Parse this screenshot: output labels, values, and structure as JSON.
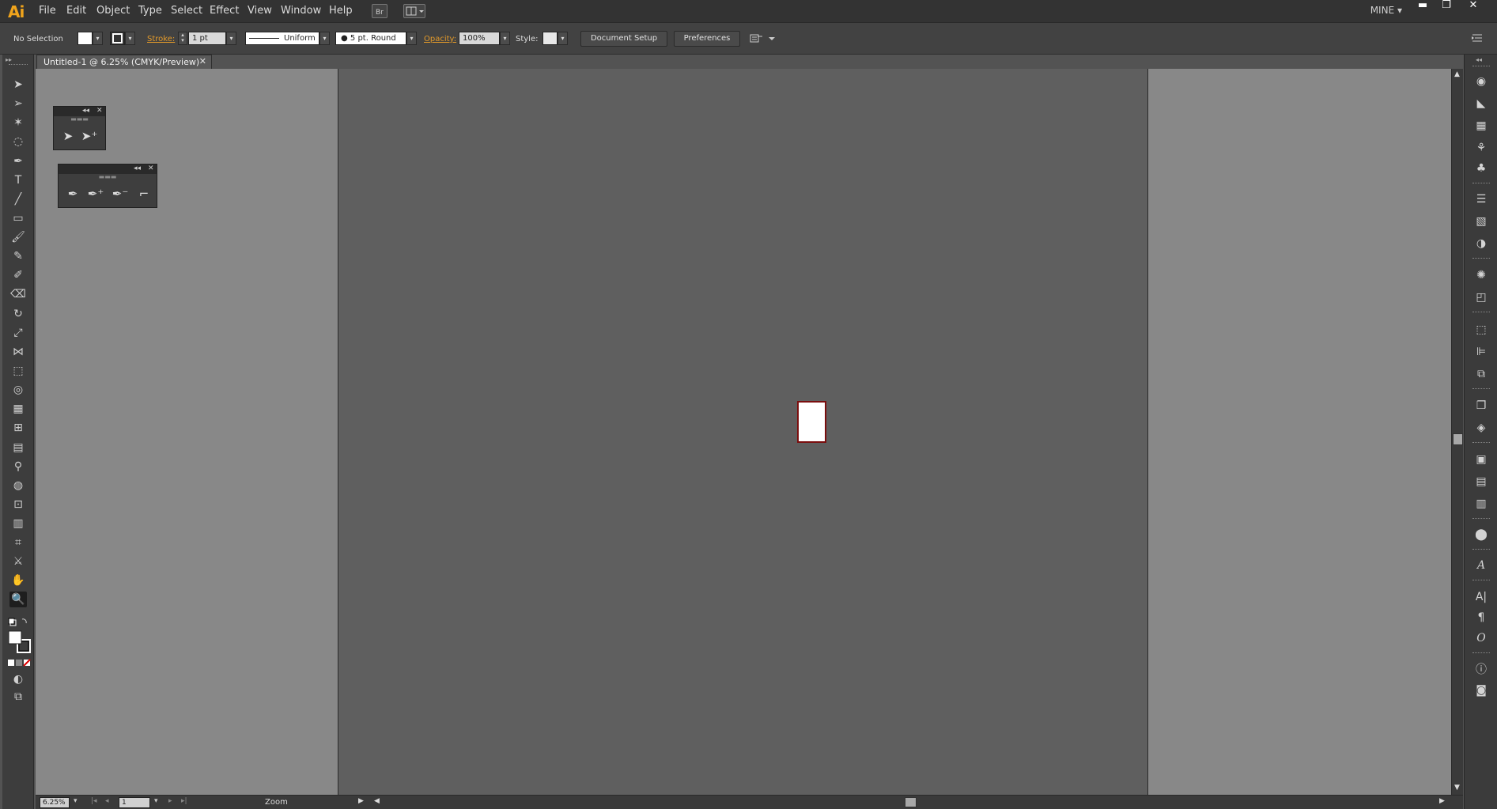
{
  "app": {
    "logo": "Ai",
    "workspace": "MINE"
  },
  "menu": [
    "File",
    "Edit",
    "Object",
    "Type",
    "Select",
    "Effect",
    "View",
    "Window",
    "Help"
  ],
  "menubar_icons": [
    "bridge-icon",
    "arrange-documents-icon"
  ],
  "window_controls": {
    "minimize": "▬",
    "maximize": "❐",
    "close": "✕"
  },
  "control_bar": {
    "selection": "No Selection",
    "stroke_label": "Stroke:",
    "stroke_weight": "1 pt",
    "stroke_profile": "Uniform",
    "brush": "● 5 pt. Round",
    "opacity_label": "Opacity:",
    "opacity_value": "100%",
    "style_label": "Style:",
    "document_setup": "Document Setup",
    "preferences": "Preferences",
    "colors": {
      "fill": "#ffffff",
      "link": "#e39a2a"
    }
  },
  "document": {
    "tab_title": "Untitled-1 @ 6.25% (CMYK/Preview)",
    "close": "✕"
  },
  "status_bar": {
    "zoom": "6.25%",
    "artboard": "1",
    "tool": "Zoom"
  },
  "tools": [
    "selection-tool-icon",
    "direct-selection-tool-icon",
    "magic-wand-tool-icon",
    "lasso-tool-icon",
    "pen-tool-icon",
    "type-tool-icon",
    "line-segment-tool-icon",
    "rectangle-tool-icon",
    "paintbrush-tool-icon",
    "pencil-tool-icon",
    "blob-brush-tool-icon",
    "eraser-tool-icon",
    "rotate-tool-icon",
    "scale-tool-icon",
    "width-tool-icon",
    "free-transform-tool-icon",
    "shape-builder-tool-icon",
    "perspective-grid-tool-icon",
    "mesh-tool-icon",
    "gradient-tool-icon",
    "eyedropper-tool-icon",
    "blend-tool-icon",
    "symbol-sprayer-tool-icon",
    "graph-tool-icon",
    "artboard-tool-icon",
    "slice-tool-icon",
    "hand-tool-icon",
    "zoom-tool-icon"
  ],
  "colors": {
    "canvas": "#888888",
    "page_area": "#5f5f5f",
    "artboard_border": "#7a0e0e",
    "logo": "#f0a41c"
  }
}
